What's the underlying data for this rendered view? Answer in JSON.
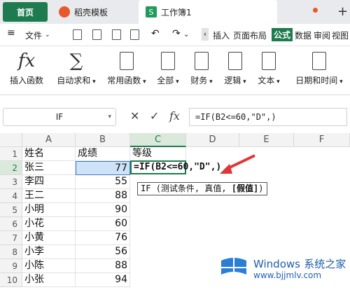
{
  "tabs": {
    "home": "首页",
    "template": "稻壳模板",
    "workbook": "工作簿1",
    "plus": "+"
  },
  "menubar": {
    "file": "文件",
    "items": [
      "插入",
      "页面布局",
      "公式",
      "数据",
      "审阅",
      "视图"
    ],
    "active": "公式"
  },
  "ribbon": [
    {
      "label": "插入函数",
      "glyph": "fx"
    },
    {
      "label": "自动求和",
      "glyph": "∑"
    },
    {
      "label": "常用函数",
      "glyph": ""
    },
    {
      "label": "全部",
      "glyph": ""
    },
    {
      "label": "财务",
      "glyph": ""
    },
    {
      "label": "逻辑",
      "glyph": ""
    },
    {
      "label": "文本",
      "glyph": ""
    },
    {
      "label": "日期和时间",
      "glyph": ""
    }
  ],
  "formula_bar": {
    "name_box": "IF",
    "formula": "=IF(B2<=60,\"D\",)",
    "fx": "fx"
  },
  "columns": [
    "A",
    "B",
    "C",
    "D",
    "E",
    "F"
  ],
  "rows": [
    "1",
    "2",
    "3",
    "4",
    "5",
    "6",
    "7",
    "8",
    "9",
    "10"
  ],
  "sheet": {
    "header": {
      "a": "姓名",
      "b": "成绩",
      "c": "等级"
    },
    "names": [
      "张三",
      "李四",
      "王二",
      "小明",
      "小花",
      "小黄",
      "小李",
      "小陈",
      "小张"
    ],
    "scores": [
      "77",
      "55",
      "88",
      "90",
      "60",
      "76",
      "56",
      "88",
      "94"
    ],
    "editing_text": "=IF(B2<=60,\"D\",)"
  },
  "tooltip": {
    "func": "IF",
    "args": "(测试条件, 真值, ",
    "bold_arg": "[假值]",
    "close": ")"
  },
  "watermark": {
    "brand": "Windows",
    "suffix": "系统之家",
    "url": "www.bjjmlv.com"
  },
  "colors": {
    "accent": "#1e7b4f",
    "selection": "#cfe3f8",
    "arrow": "#e03636"
  }
}
